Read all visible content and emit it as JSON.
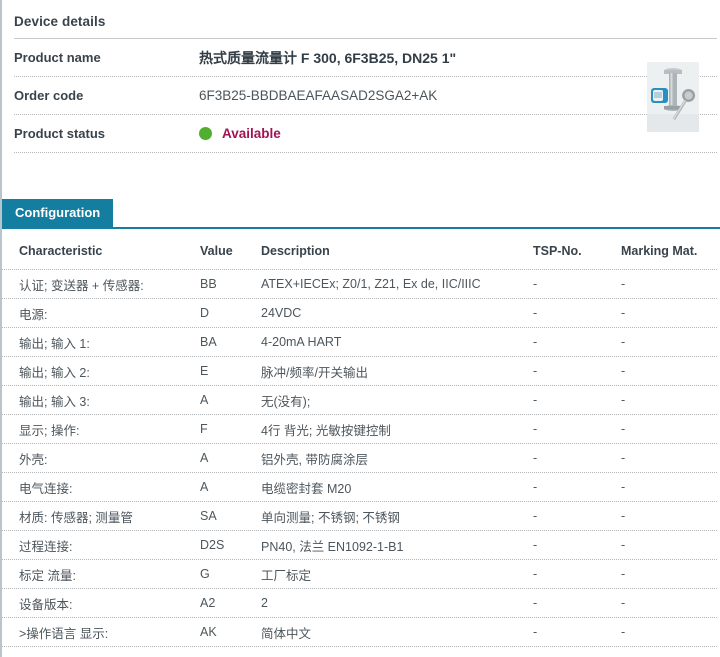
{
  "device_details": {
    "title": "Device details",
    "product_name_label": "Product name",
    "product_name_value": "热式质量流量计 F 300, 6F3B25, DN25 1\"",
    "order_code_label": "Order code",
    "order_code_value": "6F3B25-BBDBAEAFAASAD2SGA2+AK",
    "product_status_label": "Product status",
    "product_status_value": "Available",
    "product_image_icon": "flowmeter-product-photo"
  },
  "colors": {
    "accent_teal": "#147ea0",
    "status_green": "#52ae30",
    "status_magenta": "#a01355"
  },
  "tab": {
    "label": "Configuration"
  },
  "table": {
    "headers": [
      "Characteristic",
      "Value",
      "Description",
      "TSP-No.",
      "Marking Mat."
    ],
    "rows": [
      [
        "认证; 变送器 + 传感器:",
        "BB",
        "ATEX+IECEx; Z0/1, Z21, Ex de, IIC/IIIC",
        "-",
        "-"
      ],
      [
        "电源:",
        "D",
        "24VDC",
        "-",
        "-"
      ],
      [
        "输出; 输入 1:",
        "BA",
        "4-20mA HART",
        "-",
        "-"
      ],
      [
        "输出; 输入 2:",
        "E",
        "脉冲/频率/开关输出",
        "-",
        "-"
      ],
      [
        "输出; 输入 3:",
        "A",
        "无(没有);",
        "-",
        "-"
      ],
      [
        "显示; 操作:",
        "F",
        "4行 背光; 光敏按键控制",
        "-",
        "-"
      ],
      [
        "外壳:",
        "A",
        "铝外壳, 带防腐涂层",
        "-",
        "-"
      ],
      [
        "电气连接:",
        "A",
        "电缆密封套 M20",
        "-",
        "-"
      ],
      [
        "材质: 传感器; 测量管",
        "SA",
        "单向测量; 不锈钢; 不锈钢",
        "-",
        "-"
      ],
      [
        "过程连接:",
        "D2S",
        "PN40, 法兰 EN1092-1-B1",
        "-",
        "-"
      ],
      [
        "标定 流量:",
        "G",
        "工厂标定",
        "-",
        "-"
      ],
      [
        "设备版本:",
        "A2",
        "2",
        "-",
        "-"
      ],
      [
        ">操作语言 显示:",
        "AK",
        "简体中文",
        "-",
        "-"
      ]
    ]
  }
}
